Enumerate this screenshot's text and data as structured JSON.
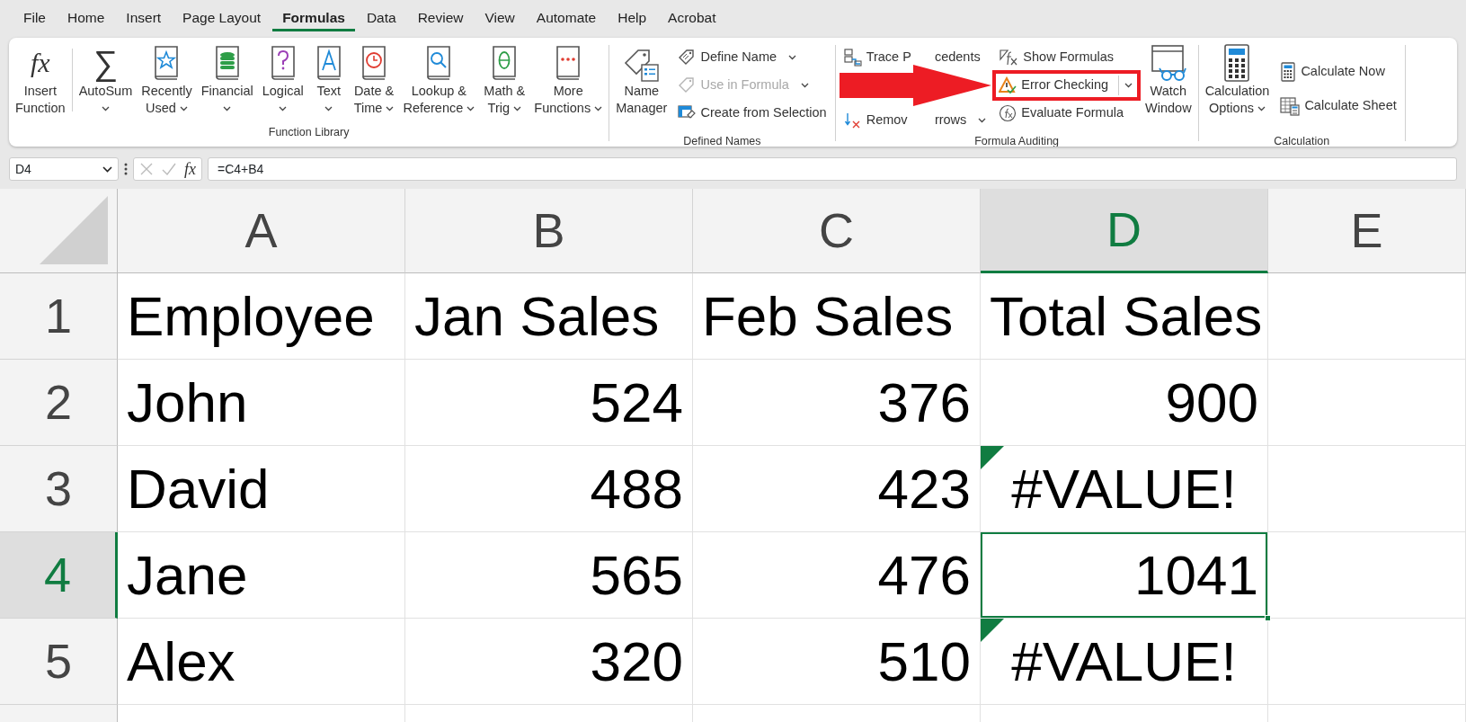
{
  "tabs": [
    {
      "label": "File",
      "selected": false
    },
    {
      "label": "Home",
      "selected": false
    },
    {
      "label": "Insert",
      "selected": false
    },
    {
      "label": "Page Layout",
      "selected": false
    },
    {
      "label": "Formulas",
      "selected": true
    },
    {
      "label": "Data",
      "selected": false
    },
    {
      "label": "Review",
      "selected": false
    },
    {
      "label": "View",
      "selected": false
    },
    {
      "label": "Automate",
      "selected": false
    },
    {
      "label": "Help",
      "selected": false
    },
    {
      "label": "Acrobat",
      "selected": false
    }
  ],
  "ribbon": {
    "groups": [
      {
        "label": "Function Library",
        "columns": [
          {
            "kind": "large",
            "icon_text": "fx",
            "lines": [
              "Insert",
              "Function"
            ],
            "caret": false
          },
          {
            "kind": "large",
            "icon_text": "∑",
            "lines": [
              "AutoSum"
            ],
            "caret": true
          },
          {
            "kind": "large",
            "lines": [
              "Recently",
              "Used"
            ],
            "caret": true
          },
          {
            "kind": "large",
            "lines": [
              "Financial"
            ],
            "caret": true
          },
          {
            "kind": "large",
            "lines": [
              "Logical"
            ],
            "caret": true
          },
          {
            "kind": "large",
            "lines": [
              "Text"
            ],
            "caret": true
          },
          {
            "kind": "large",
            "lines": [
              "Date &",
              "Time"
            ],
            "caret": true
          },
          {
            "kind": "large",
            "lines": [
              "Lookup &",
              "Reference"
            ],
            "caret": true
          },
          {
            "kind": "large",
            "lines": [
              "Math &",
              "Trig"
            ],
            "caret": true
          },
          {
            "kind": "large",
            "lines": [
              "More",
              "Functions"
            ],
            "caret": true
          }
        ]
      },
      {
        "label": "Defined Names",
        "columns": [
          {
            "kind": "large",
            "lines": [
              "Name",
              "Manager"
            ],
            "caret": false
          },
          {
            "kind": "stack",
            "items": [
              {
                "label": "Define Name",
                "caret": true,
                "disabled": false,
                "highlighted": false,
                "split": false
              },
              {
                "label": "Use in Formula",
                "caret": true,
                "disabled": true,
                "highlighted": false,
                "split": false
              },
              {
                "label": "Create from Selection",
                "caret": false,
                "disabled": false,
                "highlighted": false,
                "split": false
              }
            ]
          }
        ]
      },
      {
        "label": "Formula Auditing",
        "columns": [
          {
            "kind": "stack",
            "items": [
              {
                "label_parts": [
                  "Trace P",
                  "cedents"
                ],
                "caret": false,
                "disabled": false,
                "highlighted": false,
                "split": false
              },
              {
                "label_parts": [
                  "Remov",
                  "rrows"
                ],
                "caret": true,
                "disabled": false,
                "highlighted": false,
                "split": false
              }
            ]
          },
          {
            "kind": "stack",
            "items": [
              {
                "label": "Show Formulas",
                "caret": false,
                "disabled": false,
                "highlighted": false,
                "split": false
              },
              {
                "label": "Error Checking",
                "caret": true,
                "disabled": false,
                "highlighted": true,
                "split": true
              },
              {
                "label": "Evaluate Formula",
                "caret": false,
                "disabled": false,
                "highlighted": false,
                "split": false
              }
            ]
          },
          {
            "kind": "large",
            "lines": [
              "Watch",
              "Window"
            ],
            "caret": false
          }
        ]
      },
      {
        "label": "Calculation",
        "columns": [
          {
            "kind": "large",
            "lines": [
              "Calculation",
              "Options"
            ],
            "caret": true
          },
          {
            "kind": "stack",
            "items": [
              {
                "label": "Calculate Now",
                "caret": false,
                "disabled": false,
                "highlighted": false,
                "split": false
              },
              {
                "label": "Calculate Sheet",
                "caret": false,
                "disabled": false,
                "highlighted": false,
                "split": false
              }
            ]
          }
        ]
      }
    ]
  },
  "formula_bar": {
    "name_box": "D4",
    "fx": "fx",
    "formula": "=C4+B4"
  },
  "sheet": {
    "columns": [
      {
        "label": "A",
        "selected": false
      },
      {
        "label": "B",
        "selected": false
      },
      {
        "label": "C",
        "selected": false
      },
      {
        "label": "D",
        "selected": true
      },
      {
        "label": "E",
        "selected": false
      }
    ],
    "rows": [
      {
        "label": "1",
        "selected": false,
        "cells": [
          {
            "text": "Employee",
            "kind": "text",
            "selected": false,
            "flagged": false
          },
          {
            "text": "Jan Sales",
            "kind": "text",
            "selected": false,
            "flagged": false
          },
          {
            "text": "Feb Sales",
            "kind": "text",
            "selected": false,
            "flagged": false
          },
          {
            "text": "Total Sales",
            "kind": "text",
            "selected": false,
            "flagged": false
          },
          {
            "kind": "empty",
            "selected": false,
            "flagged": false
          }
        ]
      },
      {
        "label": "2",
        "selected": false,
        "cells": [
          {
            "text": "John",
            "kind": "text",
            "selected": false,
            "flagged": false
          },
          {
            "text": "524",
            "kind": "number",
            "selected": false,
            "flagged": false
          },
          {
            "text": "376",
            "kind": "number",
            "selected": false,
            "flagged": false
          },
          {
            "text": "900",
            "kind": "number",
            "selected": false,
            "flagged": false
          },
          {
            "kind": "empty",
            "selected": false,
            "flagged": false
          }
        ]
      },
      {
        "label": "3",
        "selected": false,
        "cells": [
          {
            "text": "David",
            "kind": "text",
            "selected": false,
            "flagged": false
          },
          {
            "text": "488",
            "kind": "number",
            "selected": false,
            "flagged": false
          },
          {
            "text": "423",
            "kind": "number",
            "selected": false,
            "flagged": false
          },
          {
            "text": "#VALUE!",
            "kind": "error",
            "selected": false,
            "flagged": true
          },
          {
            "kind": "empty",
            "selected": false,
            "flagged": false
          }
        ]
      },
      {
        "label": "4",
        "selected": true,
        "cells": [
          {
            "text": "Jane",
            "kind": "text",
            "selected": false,
            "flagged": false
          },
          {
            "text": "565",
            "kind": "number",
            "selected": false,
            "flagged": false
          },
          {
            "text": "476",
            "kind": "number",
            "selected": false,
            "flagged": false
          },
          {
            "text": "1041",
            "kind": "number",
            "selected": true,
            "flagged": false
          },
          {
            "kind": "empty",
            "selected": false,
            "flagged": false
          }
        ]
      },
      {
        "label": "5",
        "selected": false,
        "cells": [
          {
            "text": "Alex",
            "kind": "text",
            "selected": false,
            "flagged": false
          },
          {
            "text": "320",
            "kind": "number",
            "selected": false,
            "flagged": false
          },
          {
            "text": "510",
            "kind": "number",
            "selected": false,
            "flagged": false
          },
          {
            "text": "#VALUE!",
            "kind": "error",
            "selected": false,
            "flagged": true
          },
          {
            "kind": "empty",
            "selected": false,
            "flagged": false
          }
        ]
      }
    ]
  }
}
